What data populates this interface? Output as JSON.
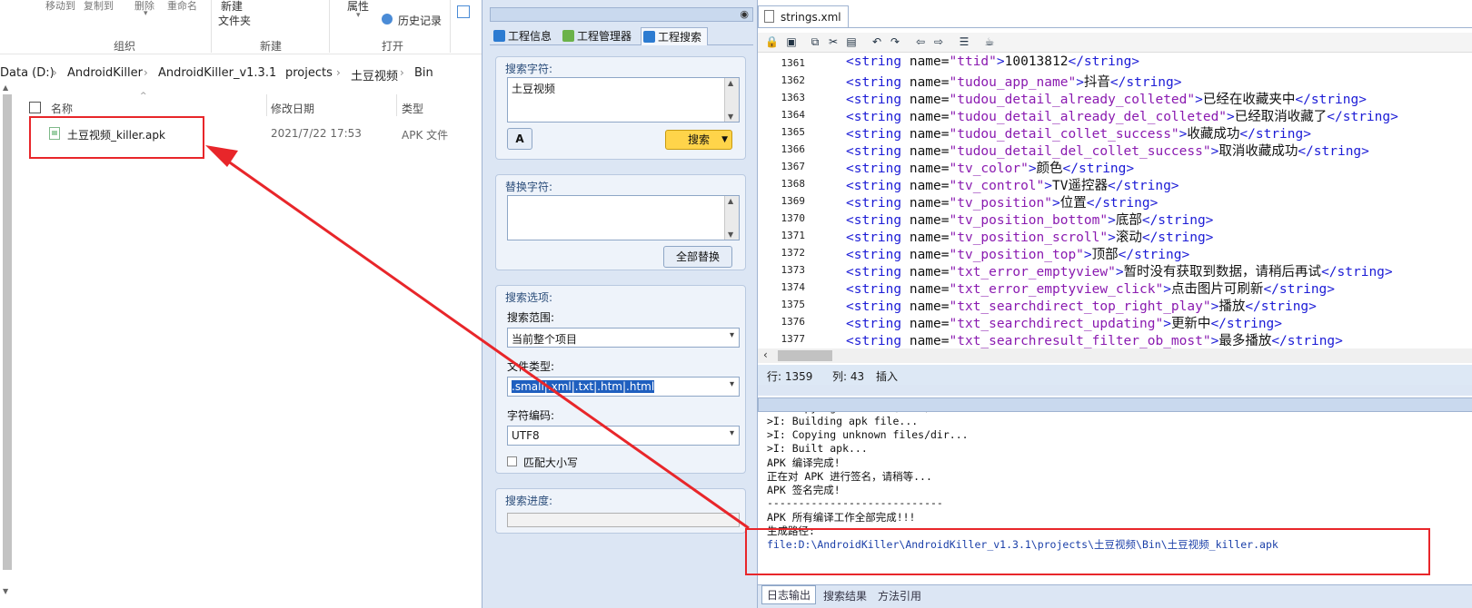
{
  "explorer": {
    "ribbon": {
      "move_to": "移动到",
      "copy_to": "复制到",
      "delete": "删除",
      "rename": "重命名",
      "new_item": "新建",
      "new_folder": "文件夹",
      "properties": "属性",
      "history": "历史记录",
      "group_organize": "组织",
      "group_new": "新建",
      "group_open": "打开"
    },
    "breadcrumb": [
      "Data (D:)",
      "AndroidKiller",
      "AndroidKiller_v1.3.1",
      "projects",
      "土豆视频",
      "Bin"
    ],
    "columns": {
      "name": "名称",
      "modified": "修改日期",
      "type": "类型"
    },
    "files": [
      {
        "name": "土豆视频_killer.apk",
        "modified": "2021/7/22 17:53",
        "type": "APK 文件"
      }
    ]
  },
  "search": {
    "tabs": [
      "工程信息",
      "工程管理器",
      "工程搜索"
    ],
    "active_tab": "工程搜索",
    "search_label": "搜索字符:",
    "search_value": "土豆视频",
    "search_button": "搜索",
    "replace_label": "替换字符:",
    "replace_value": "",
    "replace_all_button": "全部替换",
    "options_label": "搜索选项:",
    "scope_label": "搜索范围:",
    "scope_value": "当前整个项目",
    "filetype_label": "文件类型:",
    "filetype_value": ".smali|.xml|.txt|.htm|.html",
    "encoding_label": "字符编码:",
    "encoding_value": "UTF8",
    "match_case_label": "匹配大小写",
    "progress_label": "搜索进度:",
    "progress": 0
  },
  "editor": {
    "file_tab": "strings.xml",
    "lines": [
      {
        "n": "1361",
        "name": "ttid",
        "text": "10013812"
      },
      {
        "n": "1362",
        "name": "tudou_app_name",
        "text": "抖音"
      },
      {
        "n": "1363",
        "name": "tudou_detail_already_colleted",
        "text": "已经在收藏夹中"
      },
      {
        "n": "1364",
        "name": "tudou_detail_already_del_colleted",
        "text": "已经取消收藏了"
      },
      {
        "n": "1365",
        "name": "tudou_detail_collet_success",
        "text": "收藏成功"
      },
      {
        "n": "1366",
        "name": "tudou_detail_del_collet_success",
        "text": "取消收藏成功"
      },
      {
        "n": "1367",
        "name": "tv_color",
        "text": "颜色"
      },
      {
        "n": "1368",
        "name": "tv_control",
        "text": "TV遥控器"
      },
      {
        "n": "1369",
        "name": "tv_position",
        "text": "位置"
      },
      {
        "n": "1370",
        "name": "tv_position_bottom",
        "text": "底部"
      },
      {
        "n": "1371",
        "name": "tv_position_scroll",
        "text": "滚动"
      },
      {
        "n": "1372",
        "name": "tv_position_top",
        "text": "顶部"
      },
      {
        "n": "1373",
        "name": "txt_error_emptyview",
        "text": "暂时没有获取到数据，请稍后再试"
      },
      {
        "n": "1374",
        "name": "txt_error_emptyview_click",
        "text": "点击图片可刷新"
      },
      {
        "n": "1375",
        "name": "txt_searchdirect_top_right_play",
        "text": "播放"
      },
      {
        "n": "1376",
        "name": "txt_searchdirect_updating",
        "text": "更新中"
      },
      {
        "n": "1377",
        "name": "txt_searchresult_filter_ob_most",
        "text": "最多播放"
      }
    ],
    "status": {
      "row": "行: 1359",
      "col": "列: 43",
      "mode": "插入"
    },
    "log": [
      ">I: Copying libs... (/lib)",
      ">I: Building apk file...",
      ">I: Copying unknown files/dir...",
      ">I: Built apk...",
      "APK 编译完成!",
      "正在对 APK 进行签名，请稍等...",
      "APK 签名完成!",
      "----------------------------",
      "APK 所有编译工作全部完成!!!",
      "生成路径:",
      "file:D:\\AndroidKiller\\AndroidKiller_v1.3.1\\projects\\土豆视频\\Bin\\土豆视频_killer.apk"
    ],
    "log_tabs": [
      "日志输出",
      "搜索结果",
      "方法引用"
    ]
  },
  "colors": {
    "highlight": "#e8262a",
    "tag": "#1b1bd6",
    "value": "#8a1ab0",
    "accent": "#1f5fbf"
  }
}
